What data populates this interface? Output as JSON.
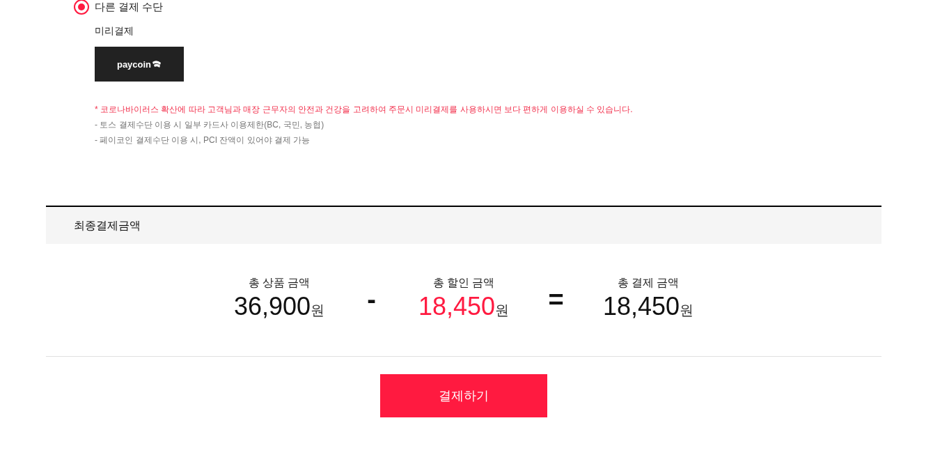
{
  "payment_option": {
    "label": "다른 결제 수단",
    "selected": true
  },
  "prepay": {
    "title": "미리결제",
    "methods": [
      {
        "logo_text": "paycoin",
        "selected": false
      }
    ]
  },
  "notices": [
    {
      "kind": "warning",
      "text": "* 코로나바이러스 확산에 따라 고객님과 매장 근무자의 안전과 건강을 고려하여 주문시 미리결제를 사용하시면 보다 편하게 이용하실 수 있습니다."
    },
    {
      "kind": "note",
      "text": "- 토스 결제수단 이용 시 일부 카드사 이용제한(BC, 국민, 농협)"
    },
    {
      "kind": "note",
      "text": "- 페이코인 결제수단 이용 시, PCI 잔액이 있어야 결제 가능"
    }
  ],
  "summary": {
    "title": "최종결제금액",
    "items": [
      {
        "kind": "amount",
        "label": "총 상품 금액",
        "value": "36,900",
        "unit": "원",
        "highlight": false
      },
      {
        "kind": "operator",
        "symbol": "-"
      },
      {
        "kind": "amount",
        "label": "총 할인 금액",
        "value": "18,450",
        "unit": "원",
        "highlight": true
      },
      {
        "kind": "operator",
        "symbol": "="
      },
      {
        "kind": "amount",
        "label": "총 결제 금액",
        "value": "18,450",
        "unit": "원",
        "highlight": false
      }
    ]
  },
  "submit_button": {
    "label": "결제하기"
  }
}
